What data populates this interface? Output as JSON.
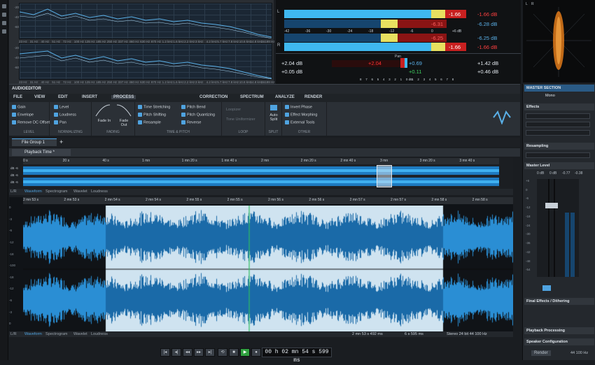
{
  "spectrum": {
    "db_labels": [
      "-20",
      "-30",
      "-40",
      "-50",
      "-60",
      "-70",
      "-80",
      "-90",
      "-100"
    ],
    "freq_labels": [
      "23 Hz",
      "31 Hz",
      "40 Hz",
      "51 Hz",
      "72 Hz",
      "100 Hz",
      "135 Hz",
      "185 Hz",
      "250 Hz",
      "337 Hz",
      "460 Hz",
      "630 Hz",
      "870 Hz",
      "1.2 kHz",
      "1.6 kHz",
      "2.2 kHz",
      "3 kHz",
      "4.2 kHz",
      "5.7 kHz",
      "7.8 kHz",
      "10.8 kHz",
      "14.8 kHz",
      "16199 Hz"
    ]
  },
  "meter": {
    "L_peak": "-1.66",
    "L_rms": "-6.31",
    "L_db": "-1.66 dB",
    "L_db2": "-6.28 dB",
    "R_peak": "-1.66",
    "R_rms": "-6.25",
    "R_db": "-6.25 dB",
    "R_db2": "-1.66 dB",
    "scale": [
      "-42",
      "-36",
      "-30",
      "-24",
      "-18",
      "-12",
      "-6",
      "0",
      "+6 dB"
    ],
    "pan_label": "Pan",
    "left_val1": "+2.04 dB",
    "left_val2": "+0.05 dB",
    "pan_red": "+2.04",
    "pan_blue": "+0.69",
    "pan_green": "+0.11",
    "right_val1": "+1.42 dB",
    "right_val2": "+0.46 dB",
    "pan_scale": [
      "8",
      "7",
      "6",
      "5",
      "4",
      "3",
      "2",
      "1",
      "0 dB",
      "1",
      "2",
      "3",
      "4",
      "5",
      "6",
      "7",
      "8"
    ],
    "left_ch": "L",
    "right_ch": "R",
    "colors": {
      "cyan": "#3fb8f0",
      "yellow": "#e8e060",
      "red": "#c82020",
      "dark_blue": "#16456e"
    }
  },
  "scope": {
    "labels": [
      "L",
      "R"
    ],
    "color": "#e07a1a"
  },
  "app": {
    "name": "AUDIOEDITOR"
  },
  "menu_tabs": [
    "FILE",
    "VIEW",
    "EDIT",
    "INSERT",
    "PROCESS"
  ],
  "menu_tabs_right": [
    "CORRECTION",
    "SPECTRUM",
    "ANALYZE",
    "RENDER"
  ],
  "ribbon": {
    "level_items": [
      "Gain",
      "Envelope",
      "Remove DC Offset"
    ],
    "level_cap": "LEVEL",
    "norm_items": [
      "Level",
      "Loudness",
      "Pan"
    ],
    "norm_cap": "NORMALIZING",
    "fade_in": "Fade In",
    "fade_out": "Fade Out",
    "fade_cap": "FADING",
    "tp_items": [
      "Time Stretching",
      "Pitch Shifting",
      "Resample"
    ],
    "tp_items2": [
      "Pitch Bend",
      "Pitch Quantizing",
      "Reverse"
    ],
    "tp_cap": "TIME & PITCH",
    "loop_items": [
      "Loopizer",
      "Tone Uniformizer"
    ],
    "loop_cap": "LOOP",
    "split_label": "Auto Split",
    "split_cap": "SPLIT",
    "other_items": [
      "Invert Phase",
      "Effect Morphing",
      "External Tools"
    ],
    "other_cap": "OTHER"
  },
  "file_group": {
    "tab": "File Group 1",
    "plus": "+"
  },
  "playback_tab": "Playback Time *",
  "overview_ruler": [
    "0 s",
    "20 s",
    "40 s",
    "1 mn",
    "1 mn 20 s",
    "1 mn 40 s",
    "2 mn",
    "2 mn 20 s",
    "2 mn 40 s",
    "3 mn",
    "3 mn 20 s",
    "3 mn 40 s"
  ],
  "overview_db": [
    "dB -6",
    "dB -6",
    "dB -6"
  ],
  "wave_tabs": [
    "Waveform",
    "Spectrogram",
    "Wavelet",
    "Loudness"
  ],
  "lr_label": "L/R",
  "main_ruler": [
    "2 mn 53 s",
    "2 mn 53 s",
    "2 mn 54 s",
    "2 mn 54 s",
    "2 mn 55 s",
    "2 mn 55 s",
    "2 mn 56 s",
    "2 mn 56 s",
    "2 mn 57 s",
    "2 mn 57 s",
    "2 mn 58 s",
    "2 mn 58 s"
  ],
  "main_db": [
    "0",
    "-3",
    "-6",
    "-12",
    "-18",
    "-100",
    "-18",
    "-12",
    "-6",
    "-3",
    "0"
  ],
  "status": {
    "sel_start": "2 mn 53 s 492 ms",
    "sel_len": "6 s 595 ms",
    "format": "Stereo 24 bit 44 100 Hz"
  },
  "transport": {
    "timecode": "00 h 02 mn 54 s 599 ms"
  },
  "master": {
    "title": "MASTER SECTION",
    "mono": "Mono",
    "effects": "Effects",
    "resampling": "Resampling",
    "master_level": "Master Level",
    "db_readouts": [
      "0 dB",
      "0 dB",
      "-0.77",
      "-0.38"
    ],
    "fader_scale": [
      "+6",
      "0",
      "-6",
      "-12",
      "-18",
      "-24",
      "-30",
      "-36",
      "-42",
      "-48",
      "-54"
    ],
    "final_effects": "Final Effects / Dithering",
    "playback_processing": "Playback Processing",
    "speaker_config": "Speaker Configuration",
    "render": "Render",
    "rate": "44 100 Hz"
  }
}
